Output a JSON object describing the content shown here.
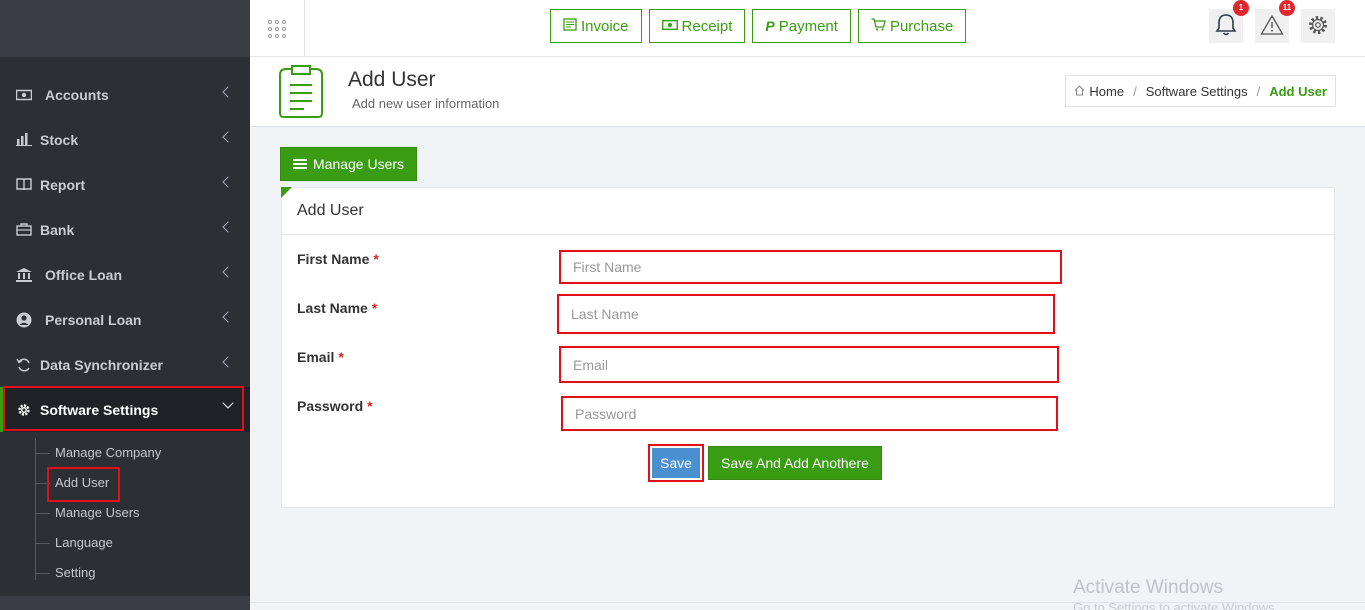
{
  "sidebar": {
    "items": [
      {
        "label": "Accounts",
        "icon": "money-icon"
      },
      {
        "label": "Stock",
        "icon": "bar-chart-icon"
      },
      {
        "label": "Report",
        "icon": "book-icon"
      },
      {
        "label": "Bank",
        "icon": "safe-icon"
      },
      {
        "label": "Office Loan",
        "icon": "bank-icon"
      },
      {
        "label": "Personal Loan",
        "icon": "user-circle-icon"
      },
      {
        "label": "Data Synchronizer",
        "icon": "sync-icon"
      },
      {
        "label": "Software Settings",
        "icon": "gear-icon"
      }
    ],
    "submenu": [
      "Manage Company",
      "Add User",
      "Manage Users",
      "Language",
      "Setting"
    ]
  },
  "topbar": {
    "quick_buttons": [
      {
        "label": "Invoice",
        "icon": "invoice-icon"
      },
      {
        "label": "Receipt",
        "icon": "receipt-icon"
      },
      {
        "label": "Payment",
        "icon": "paypal-icon"
      },
      {
        "label": "Purchase",
        "icon": "cart-icon"
      }
    ],
    "notifications_count": "1",
    "alerts_count": "11"
  },
  "page": {
    "title": "Add User",
    "subtitle": "Add new user information"
  },
  "breadcrumb": {
    "home": "Home",
    "parent": "Software Settings",
    "current": "Add User"
  },
  "manage_users_label": "Manage Users",
  "form": {
    "title": "Add User",
    "required_mark": "*",
    "fields": [
      {
        "label": "First Name",
        "placeholder": "First Name"
      },
      {
        "label": "Last Name",
        "placeholder": "Last Name"
      },
      {
        "label": "Email",
        "placeholder": "Email"
      },
      {
        "label": "Password",
        "placeholder": "Password"
      }
    ],
    "save_label": "Save",
    "save_add_label": "Save And Add Anothere"
  },
  "watermark": {
    "line1": "Activate Windows",
    "line2": "Go to Settings to activate Windows."
  },
  "colors": {
    "accent": "#3a9c12",
    "sidebar_bg": "#2c2f33",
    "highlight": "#e0101a",
    "save_blue": "#4a8fd0"
  }
}
